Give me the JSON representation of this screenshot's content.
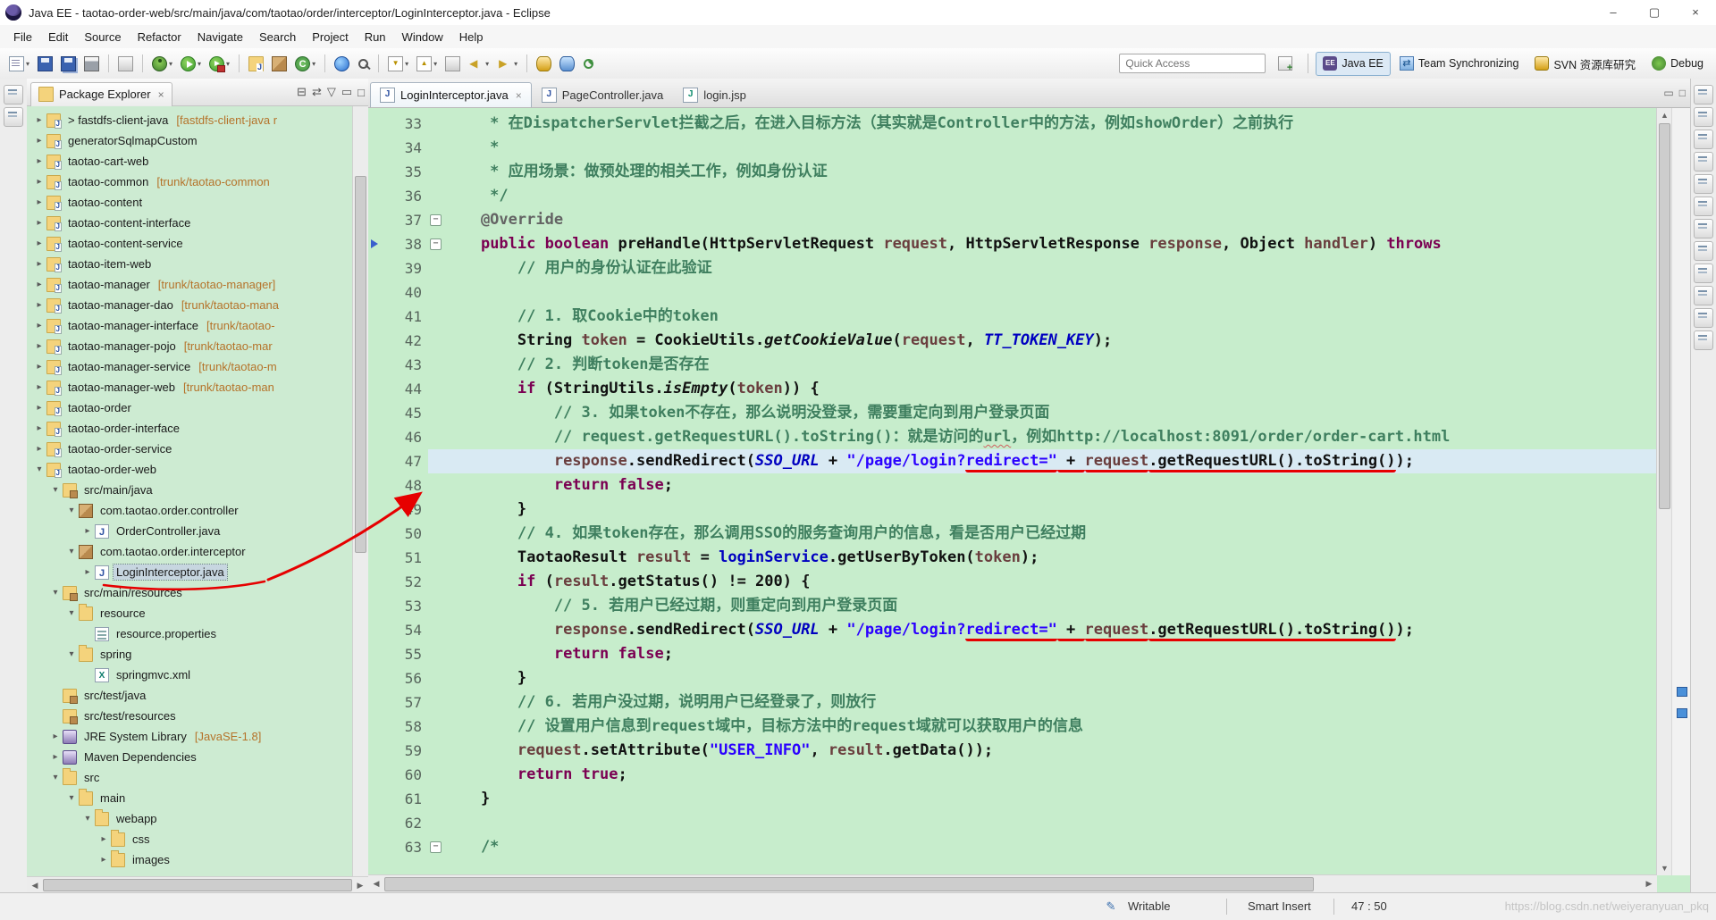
{
  "window": {
    "title": "Java EE - taotao-order-web/src/main/java/com/taotao/order/interceptor/LoginInterceptor.java - Eclipse",
    "controls": {
      "minimize": "–",
      "maximize": "▢",
      "close": "×"
    }
  },
  "colors": {
    "editor_background": "#C7EDCC",
    "current_line": "#D9EAF3",
    "keyword": "#7B0052",
    "comment": "#3F7F5F",
    "string": "#2A00FF",
    "field": "#0000C0",
    "annotation_marker": "#E60000"
  },
  "menubar": {
    "items": [
      "File",
      "Edit",
      "Source",
      "Refactor",
      "Navigate",
      "Search",
      "Project",
      "Run",
      "Window",
      "Help"
    ]
  },
  "toolbar": {
    "quick_access_label": "Quick Access",
    "items": [
      {
        "name": "new-wizard",
        "cls": "ic-page",
        "caret": true
      },
      {
        "name": "save",
        "cls": "ic-floppy"
      },
      {
        "name": "save-all",
        "cls": "ic-floppy2"
      },
      {
        "name": "print",
        "cls": "ic-printer"
      },
      {
        "sep": true
      },
      {
        "name": "build-all",
        "cls": "ic-generic"
      },
      {
        "sep": true
      },
      {
        "name": "debug",
        "cls": "ic-bug",
        "caret": true
      },
      {
        "name": "run",
        "cls": "ic-play",
        "caret": true
      },
      {
        "name": "run-external-tools",
        "cls": "ic-play2",
        "caret": true
      },
      {
        "sep": true
      },
      {
        "name": "new-java-project",
        "cls": "ic-folderj"
      },
      {
        "name": "new-package",
        "cls": "ic-pkg"
      },
      {
        "name": "new-class",
        "cls": "ic-class",
        "caret": true
      },
      {
        "sep": true
      },
      {
        "name": "open-web-browser",
        "cls": "ic-globe"
      },
      {
        "name": "search",
        "cls": "ic-search"
      },
      {
        "sep": true
      },
      {
        "name": "next-annotation",
        "cls": "ic-navdown",
        "caret": true
      },
      {
        "name": "previous-annotation",
        "cls": "ic-navup",
        "caret": true
      },
      {
        "name": "last-edit-location",
        "cls": "ic-generic"
      },
      {
        "name": "back",
        "cls": "ic-back",
        "caret": true
      },
      {
        "name": "forward",
        "cls": "ic-fwd",
        "caret": true
      },
      {
        "sep": true
      },
      {
        "name": "svn-update",
        "cls": "ic-db"
      },
      {
        "name": "svn-commit",
        "cls": "ic-db2"
      },
      {
        "name": "synchronize",
        "cls": "ic-sync"
      }
    ],
    "perspectives": [
      {
        "label": "Java EE",
        "icon": "pi-javaee",
        "active": true
      },
      {
        "label": "Team Synchronizing",
        "icon": "pi-teamsync",
        "active": false
      },
      {
        "label": "SVN 资源库研究",
        "icon": "pi-svn",
        "active": false
      },
      {
        "label": "Debug",
        "icon": "pi-debugp",
        "active": false
      }
    ]
  },
  "package_explorer": {
    "title": "Package Explorer",
    "items": [
      {
        "i": 0,
        "s": "c",
        "icon": "prj",
        "label": "> fastdfs-client-java",
        "dec": "[fastdfs-client-java r"
      },
      {
        "i": 0,
        "s": "c",
        "icon": "prj",
        "label": "generatorSqlmapCustom"
      },
      {
        "i": 0,
        "s": "c",
        "icon": "prj",
        "label": "taotao-cart-web"
      },
      {
        "i": 0,
        "s": "c",
        "icon": "prj",
        "label": "taotao-common",
        "dec": "[trunk/taotao-common"
      },
      {
        "i": 0,
        "s": "c",
        "icon": "prj",
        "label": "taotao-content"
      },
      {
        "i": 0,
        "s": "c",
        "icon": "prj",
        "label": "taotao-content-interface"
      },
      {
        "i": 0,
        "s": "c",
        "icon": "prj",
        "label": "taotao-content-service"
      },
      {
        "i": 0,
        "s": "c",
        "icon": "prj",
        "label": "taotao-item-web"
      },
      {
        "i": 0,
        "s": "c",
        "icon": "prj",
        "label": "taotao-manager",
        "dec": "[trunk/taotao-manager]"
      },
      {
        "i": 0,
        "s": "c",
        "icon": "prj",
        "label": "taotao-manager-dao",
        "dec": "[trunk/taotao-mana"
      },
      {
        "i": 0,
        "s": "c",
        "icon": "prj",
        "label": "taotao-manager-interface",
        "dec": "[trunk/taotao-"
      },
      {
        "i": 0,
        "s": "c",
        "icon": "prj",
        "label": "taotao-manager-pojo",
        "dec": "[trunk/taotao-mar"
      },
      {
        "i": 0,
        "s": "c",
        "icon": "prj",
        "label": "taotao-manager-service",
        "dec": "[trunk/taotao-m"
      },
      {
        "i": 0,
        "s": "c",
        "icon": "prj",
        "label": "taotao-manager-web",
        "dec": "[trunk/taotao-man"
      },
      {
        "i": 0,
        "s": "c",
        "icon": "prj",
        "label": "taotao-order"
      },
      {
        "i": 0,
        "s": "c",
        "icon": "prj",
        "label": "taotao-order-interface"
      },
      {
        "i": 0,
        "s": "c",
        "icon": "prj",
        "label": "taotao-order-service"
      },
      {
        "i": 0,
        "s": "e",
        "icon": "prj",
        "label": "taotao-order-web"
      },
      {
        "i": 1,
        "s": "e",
        "icon": "src",
        "label": "src/main/java"
      },
      {
        "i": 2,
        "s": "e",
        "icon": "pkg",
        "label": "com.taotao.order.controller"
      },
      {
        "i": 3,
        "s": "c",
        "icon": "java",
        "label": "OrderController.java"
      },
      {
        "i": 2,
        "s": "e",
        "icon": "pkg",
        "label": "com.taotao.order.interceptor"
      },
      {
        "i": 3,
        "s": "c",
        "icon": "java",
        "label": "LoginInterceptor.java",
        "selected": true
      },
      {
        "i": 1,
        "s": "e",
        "icon": "src",
        "label": "src/main/resources"
      },
      {
        "i": 2,
        "s": "e",
        "icon": "folder",
        "label": "resource"
      },
      {
        "i": 3,
        "s": "l",
        "icon": "prop",
        "label": "resource.properties"
      },
      {
        "i": 2,
        "s": "e",
        "icon": "folder",
        "label": "spring"
      },
      {
        "i": 3,
        "s": "l",
        "icon": "xml",
        "label": "springmvc.xml"
      },
      {
        "i": 1,
        "s": "l",
        "icon": "src",
        "label": "src/test/java"
      },
      {
        "i": 1,
        "s": "l",
        "icon": "src",
        "label": "src/test/resources"
      },
      {
        "i": 1,
        "s": "c",
        "icon": "lib",
        "label": "JRE System Library",
        "dec": "[JavaSE-1.8]"
      },
      {
        "i": 1,
        "s": "c",
        "icon": "lib",
        "label": "Maven Dependencies"
      },
      {
        "i": 1,
        "s": "e",
        "icon": "folder",
        "label": "src"
      },
      {
        "i": 2,
        "s": "e",
        "icon": "folder",
        "label": "main"
      },
      {
        "i": 3,
        "s": "e",
        "icon": "folder",
        "label": "webapp"
      },
      {
        "i": 4,
        "s": "c",
        "icon": "folder",
        "label": "css"
      },
      {
        "i": 4,
        "s": "c",
        "icon": "folder",
        "label": "images"
      }
    ]
  },
  "editor": {
    "tabs": [
      {
        "label": "LoginInterceptor.java",
        "icon": "java",
        "active": true
      },
      {
        "label": "PageController.java",
        "icon": "java",
        "active": false
      },
      {
        "label": "login.jsp",
        "icon": "jsp",
        "active": false
      }
    ],
    "lines": [
      {
        "n": 33,
        "t": [
          [
            "c",
            "     * 在DispatcherServlet拦截之后，在进入目标方法（其实就是Controller中的方法，例如showOrder）之前执行"
          ]
        ]
      },
      {
        "n": 34,
        "t": [
          [
            "c",
            "     * "
          ]
        ]
      },
      {
        "n": 35,
        "t": [
          [
            "c",
            "     * 应用场景：做预处理的相关工作，例如身份认证"
          ]
        ]
      },
      {
        "n": 36,
        "t": [
          [
            "c",
            "     */"
          ]
        ]
      },
      {
        "n": 37,
        "fold": "m",
        "t": [
          [
            "a",
            "    @Override"
          ]
        ]
      },
      {
        "n": 38,
        "fold": "m",
        "marker": "a",
        "t": [
          [
            "p",
            "    "
          ],
          [
            "k",
            "public"
          ],
          [
            "p",
            " "
          ],
          [
            "k",
            "boolean"
          ],
          [
            "p",
            " preHandle(HttpServletRequest "
          ],
          [
            "v",
            "request"
          ],
          [
            "p",
            ", HttpServletResponse "
          ],
          [
            "v",
            "response"
          ],
          [
            "p",
            ", Object "
          ],
          [
            "v",
            "handler"
          ],
          [
            "p",
            ") "
          ],
          [
            "k",
            "throws"
          ]
        ]
      },
      {
        "n": 39,
        "t": [
          [
            "c",
            "        // 用户的身份认证在此验证"
          ]
        ]
      },
      {
        "n": 40,
        "t": []
      },
      {
        "n": 41,
        "t": [
          [
            "c",
            "        // 1. 取Cookie中的token"
          ]
        ]
      },
      {
        "n": 42,
        "t": [
          [
            "p",
            "        String "
          ],
          [
            "v",
            "token"
          ],
          [
            "p",
            " = CookieUtils."
          ],
          [
            "sm",
            "getCookieValue"
          ],
          [
            "p",
            "("
          ],
          [
            "v",
            "request"
          ],
          [
            "p",
            ", "
          ],
          [
            "sf",
            "TT_TOKEN_KEY"
          ],
          [
            "p",
            ");"
          ]
        ]
      },
      {
        "n": 43,
        "t": [
          [
            "c",
            "        // 2. 判断token是否存在"
          ]
        ]
      },
      {
        "n": 44,
        "t": [
          [
            "p",
            "        "
          ],
          [
            "k",
            "if"
          ],
          [
            "p",
            " (StringUtils."
          ],
          [
            "sm",
            "isEmpty"
          ],
          [
            "p",
            "("
          ],
          [
            "v",
            "token"
          ],
          [
            "p",
            ")) {"
          ]
        ]
      },
      {
        "n": 45,
        "t": [
          [
            "c",
            "            // 3. 如果token不存在，那么说明没登录，需要重定向到用户登录页面"
          ]
        ]
      },
      {
        "n": 46,
        "t": [
          [
            "c",
            "            // request.getRequestURL().toString()：就是访问的"
          ],
          [
            "c w",
            "url"
          ],
          [
            "c",
            "，例如http://localhost:8091/order/order-cart.html"
          ]
        ]
      },
      {
        "n": 47,
        "hl": true,
        "t": [
          [
            "p",
            "            "
          ],
          [
            "v",
            "response"
          ],
          [
            "p",
            ".sendRedirect("
          ],
          [
            "sf",
            "SSO_URL"
          ],
          [
            "p",
            " + "
          ],
          [
            "s",
            "\"/page/login?"
          ],
          [
            "s u",
            "redirect=\""
          ],
          [
            "p u",
            " + "
          ],
          [
            "v u",
            "request"
          ],
          [
            "p u",
            ".getRequestURL().toString()"
          ],
          [
            "p",
            ");"
          ]
        ]
      },
      {
        "n": 48,
        "t": [
          [
            "p",
            "            "
          ],
          [
            "k",
            "return"
          ],
          [
            "p",
            " "
          ],
          [
            "k",
            "false"
          ],
          [
            "p",
            ";"
          ]
        ]
      },
      {
        "n": 49,
        "t": [
          [
            "p",
            "        }"
          ]
        ]
      },
      {
        "n": 50,
        "t": [
          [
            "c",
            "        // 4. 如果token存在，那么调用SSO的服务查询用户的信息，看是否用户已经过期"
          ]
        ]
      },
      {
        "n": 51,
        "t": [
          [
            "p",
            "        TaotaoResult "
          ],
          [
            "v",
            "result"
          ],
          [
            "p",
            " = "
          ],
          [
            "f",
            "loginService"
          ],
          [
            "p",
            ".getUserByToken("
          ],
          [
            "v",
            "token"
          ],
          [
            "p",
            ");"
          ]
        ]
      },
      {
        "n": 52,
        "t": [
          [
            "p",
            "        "
          ],
          [
            "k",
            "if"
          ],
          [
            "p",
            " ("
          ],
          [
            "v",
            "result"
          ],
          [
            "p",
            ".getStatus() != 200) {"
          ]
        ]
      },
      {
        "n": 53,
        "t": [
          [
            "c",
            "            // 5. 若用户已经过期，则重定向到用户登录页面"
          ]
        ]
      },
      {
        "n": 54,
        "t": [
          [
            "p",
            "            "
          ],
          [
            "v",
            "response"
          ],
          [
            "p",
            ".sendRedirect("
          ],
          [
            "sf",
            "SSO_URL"
          ],
          [
            "p",
            " + "
          ],
          [
            "s",
            "\"/page/login?"
          ],
          [
            "s u",
            "redirect=\""
          ],
          [
            "p u",
            " + "
          ],
          [
            "v u",
            "request"
          ],
          [
            "p u",
            ".getRequestURL().toString()"
          ],
          [
            "p",
            ");"
          ]
        ]
      },
      {
        "n": 55,
        "t": [
          [
            "p",
            "            "
          ],
          [
            "k",
            "return"
          ],
          [
            "p",
            " "
          ],
          [
            "k",
            "false"
          ],
          [
            "p",
            ";"
          ]
        ]
      },
      {
        "n": 56,
        "t": [
          [
            "p",
            "        }"
          ]
        ]
      },
      {
        "n": 57,
        "t": [
          [
            "c",
            "        // 6. 若用户没过期，说明用户已经登录了，则放行"
          ]
        ]
      },
      {
        "n": 58,
        "t": [
          [
            "c",
            "        // 设置用户信息到request域中，目标方法中的request域就可以获取用户的信息"
          ]
        ]
      },
      {
        "n": 59,
        "t": [
          [
            "p",
            "        "
          ],
          [
            "v",
            "request"
          ],
          [
            "p",
            ".setAttribute("
          ],
          [
            "s",
            "\"USER_INFO\""
          ],
          [
            "p",
            ", "
          ],
          [
            "v",
            "result"
          ],
          [
            "p",
            ".getData());"
          ]
        ]
      },
      {
        "n": 60,
        "t": [
          [
            "p",
            "        "
          ],
          [
            "k",
            "return"
          ],
          [
            "p",
            " "
          ],
          [
            "k",
            "true"
          ],
          [
            "p",
            ";"
          ]
        ]
      },
      {
        "n": 61,
        "t": [
          [
            "p",
            "    }"
          ]
        ]
      },
      {
        "n": 62,
        "t": []
      },
      {
        "n": 63,
        "fold": "m",
        "t": [
          [
            "c",
            "    /*"
          ]
        ]
      }
    ]
  },
  "statusbar": {
    "writable": "Writable",
    "smart_insert": "Smart Insert",
    "caret_position": "47 : 50",
    "watermark": "https://blog.csdn.net/weiyeranyuan_pkq"
  }
}
